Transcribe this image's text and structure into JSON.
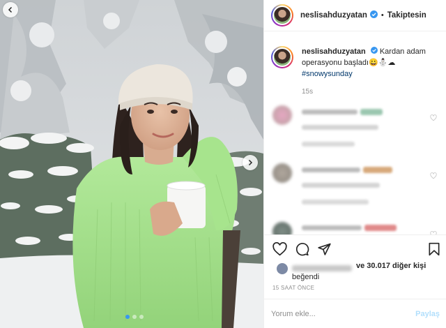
{
  "post": {
    "username": "neslisahduzyatan",
    "separator": "•",
    "follow_status": "Takiptesin",
    "caption_text": "Kardan adam operasyonu başladı😀⛄☁",
    "hashtag": "#snowysunday",
    "caption_age": "15s",
    "likes_suffix": "ve 30.017 diğer kişi",
    "likes_line2": "beğendi",
    "time_ago": "15 SAAT ÖNCE",
    "carousel": {
      "count": 3,
      "active_index": 0
    }
  },
  "comment_box": {
    "placeholder": "Yorum ekle...",
    "post_label": "Paylaş"
  },
  "icons": {
    "verified": "verified-badge-icon",
    "like": "heart-icon",
    "comment": "comment-icon",
    "share": "paper-plane-icon",
    "save": "bookmark-icon",
    "nav": "chevron-icon"
  },
  "colors": {
    "link_blue": "#00376b",
    "verified_blue": "#3897f0",
    "post_button_disabled": "#b2dffc",
    "muted": "#8e8e8e",
    "sweater_green": "#a3e08a"
  }
}
